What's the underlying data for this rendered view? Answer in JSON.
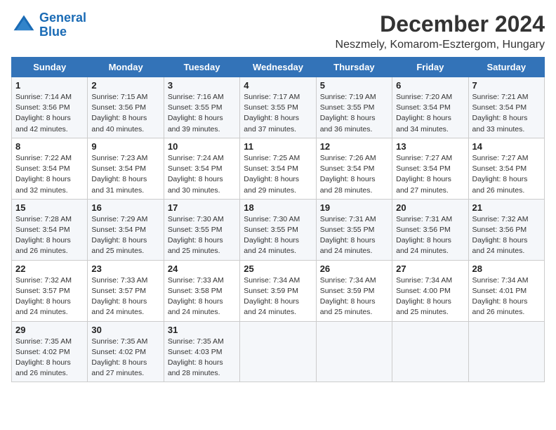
{
  "header": {
    "logo_line1": "General",
    "logo_line2": "Blue",
    "month_title": "December 2024",
    "location": "Neszmely, Komarom-Esztergom, Hungary"
  },
  "weekdays": [
    "Sunday",
    "Monday",
    "Tuesday",
    "Wednesday",
    "Thursday",
    "Friday",
    "Saturday"
  ],
  "weeks": [
    [
      {
        "day": "1",
        "sunrise": "Sunrise: 7:14 AM",
        "sunset": "Sunset: 3:56 PM",
        "daylight": "Daylight: 8 hours and 42 minutes."
      },
      {
        "day": "2",
        "sunrise": "Sunrise: 7:15 AM",
        "sunset": "Sunset: 3:56 PM",
        "daylight": "Daylight: 8 hours and 40 minutes."
      },
      {
        "day": "3",
        "sunrise": "Sunrise: 7:16 AM",
        "sunset": "Sunset: 3:55 PM",
        "daylight": "Daylight: 8 hours and 39 minutes."
      },
      {
        "day": "4",
        "sunrise": "Sunrise: 7:17 AM",
        "sunset": "Sunset: 3:55 PM",
        "daylight": "Daylight: 8 hours and 37 minutes."
      },
      {
        "day": "5",
        "sunrise": "Sunrise: 7:19 AM",
        "sunset": "Sunset: 3:55 PM",
        "daylight": "Daylight: 8 hours and 36 minutes."
      },
      {
        "day": "6",
        "sunrise": "Sunrise: 7:20 AM",
        "sunset": "Sunset: 3:54 PM",
        "daylight": "Daylight: 8 hours and 34 minutes."
      },
      {
        "day": "7",
        "sunrise": "Sunrise: 7:21 AM",
        "sunset": "Sunset: 3:54 PM",
        "daylight": "Daylight: 8 hours and 33 minutes."
      }
    ],
    [
      {
        "day": "8",
        "sunrise": "Sunrise: 7:22 AM",
        "sunset": "Sunset: 3:54 PM",
        "daylight": "Daylight: 8 hours and 32 minutes."
      },
      {
        "day": "9",
        "sunrise": "Sunrise: 7:23 AM",
        "sunset": "Sunset: 3:54 PM",
        "daylight": "Daylight: 8 hours and 31 minutes."
      },
      {
        "day": "10",
        "sunrise": "Sunrise: 7:24 AM",
        "sunset": "Sunset: 3:54 PM",
        "daylight": "Daylight: 8 hours and 30 minutes."
      },
      {
        "day": "11",
        "sunrise": "Sunrise: 7:25 AM",
        "sunset": "Sunset: 3:54 PM",
        "daylight": "Daylight: 8 hours and 29 minutes."
      },
      {
        "day": "12",
        "sunrise": "Sunrise: 7:26 AM",
        "sunset": "Sunset: 3:54 PM",
        "daylight": "Daylight: 8 hours and 28 minutes."
      },
      {
        "day": "13",
        "sunrise": "Sunrise: 7:27 AM",
        "sunset": "Sunset: 3:54 PM",
        "daylight": "Daylight: 8 hours and 27 minutes."
      },
      {
        "day": "14",
        "sunrise": "Sunrise: 7:27 AM",
        "sunset": "Sunset: 3:54 PM",
        "daylight": "Daylight: 8 hours and 26 minutes."
      }
    ],
    [
      {
        "day": "15",
        "sunrise": "Sunrise: 7:28 AM",
        "sunset": "Sunset: 3:54 PM",
        "daylight": "Daylight: 8 hours and 26 minutes."
      },
      {
        "day": "16",
        "sunrise": "Sunrise: 7:29 AM",
        "sunset": "Sunset: 3:54 PM",
        "daylight": "Daylight: 8 hours and 25 minutes."
      },
      {
        "day": "17",
        "sunrise": "Sunrise: 7:30 AM",
        "sunset": "Sunset: 3:55 PM",
        "daylight": "Daylight: 8 hours and 25 minutes."
      },
      {
        "day": "18",
        "sunrise": "Sunrise: 7:30 AM",
        "sunset": "Sunset: 3:55 PM",
        "daylight": "Daylight: 8 hours and 24 minutes."
      },
      {
        "day": "19",
        "sunrise": "Sunrise: 7:31 AM",
        "sunset": "Sunset: 3:55 PM",
        "daylight": "Daylight: 8 hours and 24 minutes."
      },
      {
        "day": "20",
        "sunrise": "Sunrise: 7:31 AM",
        "sunset": "Sunset: 3:56 PM",
        "daylight": "Daylight: 8 hours and 24 minutes."
      },
      {
        "day": "21",
        "sunrise": "Sunrise: 7:32 AM",
        "sunset": "Sunset: 3:56 PM",
        "daylight": "Daylight: 8 hours and 24 minutes."
      }
    ],
    [
      {
        "day": "22",
        "sunrise": "Sunrise: 7:32 AM",
        "sunset": "Sunset: 3:57 PM",
        "daylight": "Daylight: 8 hours and 24 minutes."
      },
      {
        "day": "23",
        "sunrise": "Sunrise: 7:33 AM",
        "sunset": "Sunset: 3:57 PM",
        "daylight": "Daylight: 8 hours and 24 minutes."
      },
      {
        "day": "24",
        "sunrise": "Sunrise: 7:33 AM",
        "sunset": "Sunset: 3:58 PM",
        "daylight": "Daylight: 8 hours and 24 minutes."
      },
      {
        "day": "25",
        "sunrise": "Sunrise: 7:34 AM",
        "sunset": "Sunset: 3:59 PM",
        "daylight": "Daylight: 8 hours and 24 minutes."
      },
      {
        "day": "26",
        "sunrise": "Sunrise: 7:34 AM",
        "sunset": "Sunset: 3:59 PM",
        "daylight": "Daylight: 8 hours and 25 minutes."
      },
      {
        "day": "27",
        "sunrise": "Sunrise: 7:34 AM",
        "sunset": "Sunset: 4:00 PM",
        "daylight": "Daylight: 8 hours and 25 minutes."
      },
      {
        "day": "28",
        "sunrise": "Sunrise: 7:34 AM",
        "sunset": "Sunset: 4:01 PM",
        "daylight": "Daylight: 8 hours and 26 minutes."
      }
    ],
    [
      {
        "day": "29",
        "sunrise": "Sunrise: 7:35 AM",
        "sunset": "Sunset: 4:02 PM",
        "daylight": "Daylight: 8 hours and 26 minutes."
      },
      {
        "day": "30",
        "sunrise": "Sunrise: 7:35 AM",
        "sunset": "Sunset: 4:02 PM",
        "daylight": "Daylight: 8 hours and 27 minutes."
      },
      {
        "day": "31",
        "sunrise": "Sunrise: 7:35 AM",
        "sunset": "Sunset: 4:03 PM",
        "daylight": "Daylight: 8 hours and 28 minutes."
      },
      null,
      null,
      null,
      null
    ]
  ]
}
